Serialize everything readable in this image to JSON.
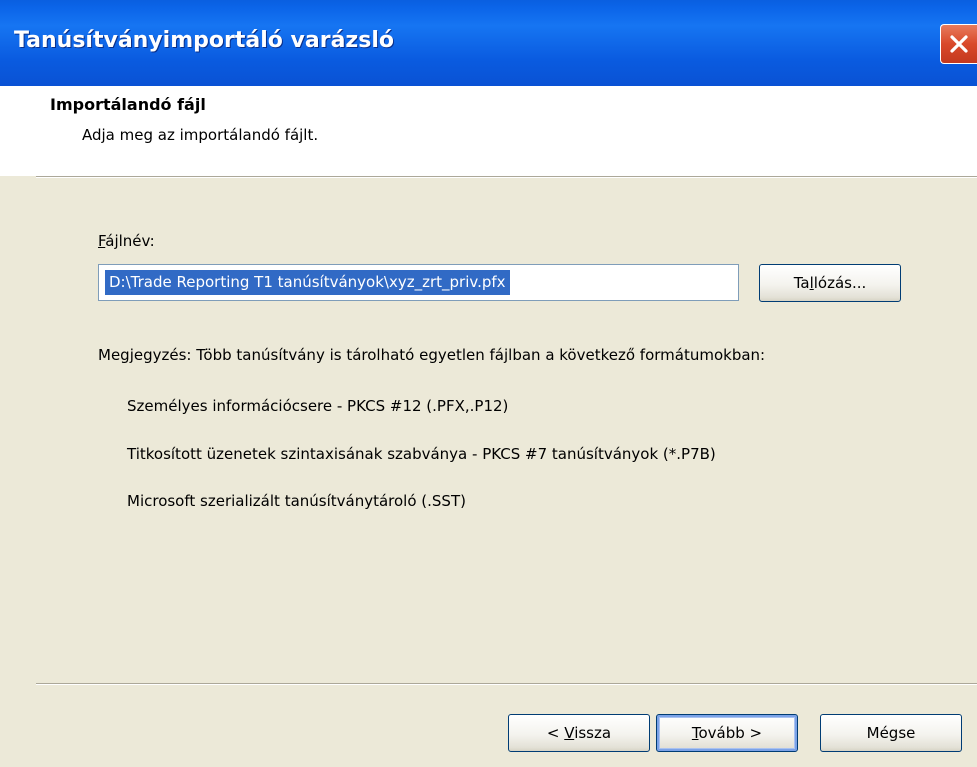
{
  "window": {
    "title": "Tanúsítványimportáló varázsló",
    "close_icon": "close-icon"
  },
  "header": {
    "title": "Importálandó fájl",
    "subtitle": "Adja meg az importálandó fájlt."
  },
  "file": {
    "label_underlined": "F",
    "label_rest": "ájlnév:",
    "value": "D:\\Trade Reporting T1 tanúsítványok\\xyz_zrt_priv.pfx",
    "browse_pre": "Ta",
    "browse_underlined": "l",
    "browse_post": "lózás..."
  },
  "note": {
    "text": "Megjegyzés: Több tanúsítvány is tárolható egyetlen fájlban a következő formátumokban:",
    "formats": [
      "Személyes információcsere - PKCS #12 (.PFX,.P12)",
      "Titkosított üzenetek szintaxisának szabványa  - PKCS #7 tanúsítványok (*.P7B)",
      "Microsoft szerializált tanúsítványtároló (.SST)"
    ]
  },
  "buttons": {
    "back_pre": "< ",
    "back_underlined": "V",
    "back_post": "issza",
    "next_underlined": "T",
    "next_post": "ovább >",
    "cancel": "Mégse"
  },
  "colors": {
    "titlebar": "#0b64e8",
    "selection": "#316ac5",
    "dialog_bg": "#ece9d8",
    "close": "#d9492a"
  }
}
